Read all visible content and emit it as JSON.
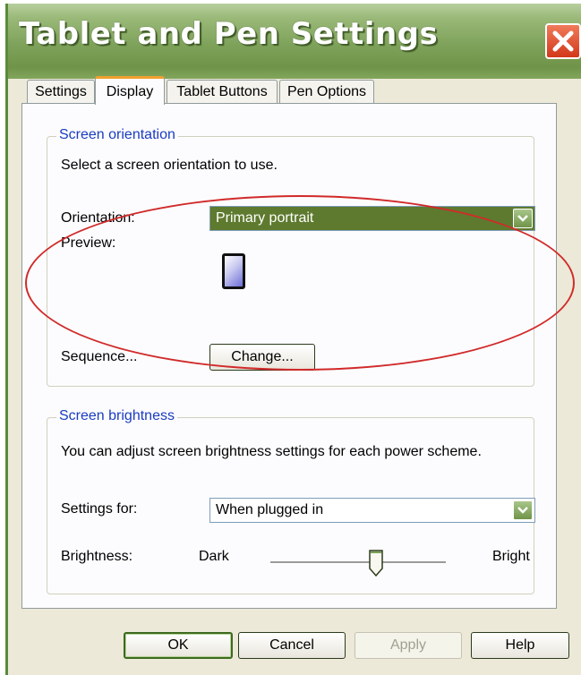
{
  "window": {
    "title": "Tablet and Pen Settings",
    "close_icon": "close-icon",
    "accent_color": "#7ea25a"
  },
  "tabs": [
    {
      "label": "Settings",
      "active": false
    },
    {
      "label": "Display",
      "active": true
    },
    {
      "label": "Tablet Buttons",
      "active": false
    },
    {
      "label": "Pen Options",
      "active": false
    }
  ],
  "screen_orientation": {
    "title": "Screen orientation",
    "description": "Select a screen orientation to use.",
    "orientation_label": "Orientation:",
    "orientation_value": "Primary portrait",
    "preview_label": "Preview:",
    "preview_icon": "portrait-screen-icon",
    "sequence_label": "Sequence...",
    "change_button": "Change..."
  },
  "screen_brightness": {
    "title": "Screen brightness",
    "description": "You can adjust screen brightness settings for each power scheme.",
    "settings_for_label": "Settings for:",
    "settings_for_value": "When plugged in",
    "brightness_label": "Brightness:",
    "dark_label": "Dark",
    "bright_label": "Bright",
    "brightness_level": 0.6
  },
  "footer": {
    "ok": "OK",
    "cancel": "Cancel",
    "apply": "Apply",
    "help": "Help"
  }
}
